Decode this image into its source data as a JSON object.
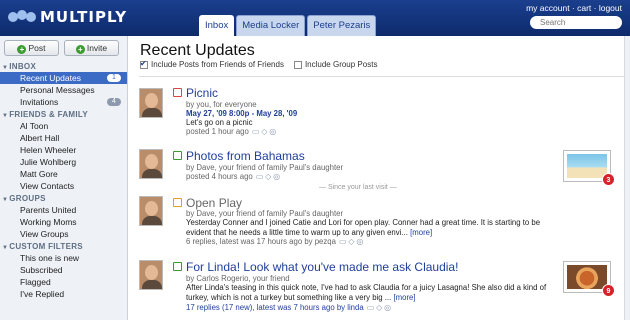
{
  "header": {
    "logo_text": "MULTIPLY",
    "tabs": [
      {
        "label": "Inbox",
        "active": true
      },
      {
        "label": "Media Locker"
      },
      {
        "label": "Peter Pezaris"
      }
    ],
    "account_links": "my account · cart · logout",
    "search_placeholder": "Search"
  },
  "sidebar": {
    "post_label": "Post",
    "invite_label": "Invite",
    "sections": {
      "inbox": "INBOX",
      "friends": "FRIENDS & FAMILY",
      "groups": "GROUPS",
      "custom": "CUSTOM FILTERS"
    },
    "inbox_items": [
      {
        "label": "Recent Updates",
        "badge": "1"
      },
      {
        "label": "Personal Messages",
        "badge": ""
      },
      {
        "label": "Invitations",
        "badge": "4"
      }
    ],
    "friends_items": [
      "Al Toon",
      "Albert Hall",
      "Helen Wheeler",
      "Julie Wohlberg",
      "Matt Gore",
      "View Contacts"
    ],
    "groups_items": [
      "Parents United",
      "Working Moms",
      "View Groups"
    ],
    "custom_items": [
      "This one is new",
      "Subscribed",
      "Flagged",
      "I've Replied"
    ]
  },
  "main": {
    "title": "Recent Updates",
    "filter1": "Include Posts from Friends of Friends",
    "filter2": "Include Group Posts",
    "since_text": "— Since your last visit —",
    "posts": [
      {
        "title": "Picnic",
        "byline": "by you, for everyone",
        "date": "May 27, '09 8:00p - May 28, '09",
        "body": "Let's go on a picnic",
        "footer": "posted 1 hour ago"
      },
      {
        "title": "Photos from Bahamas",
        "byline": "by Dave, your friend of family Paul's daughter",
        "footer": "posted 4 hours ago",
        "thumb_count": "3"
      },
      {
        "title": "Open Play",
        "byline": "by Dave, your friend of family Paul's daughter",
        "body": "Yesterday Conner and I joined Catie and Lori for open play. Conner had a great time. It is starting to be evident that he needs a little time to warm up to any given envi...",
        "more": "[more]",
        "footer": "6 replies, latest was 17 hours ago by pezqa"
      },
      {
        "title": "For Linda! Look what you've made me ask Claudia!",
        "byline": "by Carlos Rogerio, your friend",
        "body": "After Linda's teasing in this quick note, I've had to ask Claudia for a juicy Lasagna! She also did a kind of turkey, which is not a turkey but something like a very big ...",
        "more": "[more]",
        "footer_link": "17 replies (17 new), latest was 7 hours ago by linda",
        "thumb_count": "9"
      }
    ]
  }
}
